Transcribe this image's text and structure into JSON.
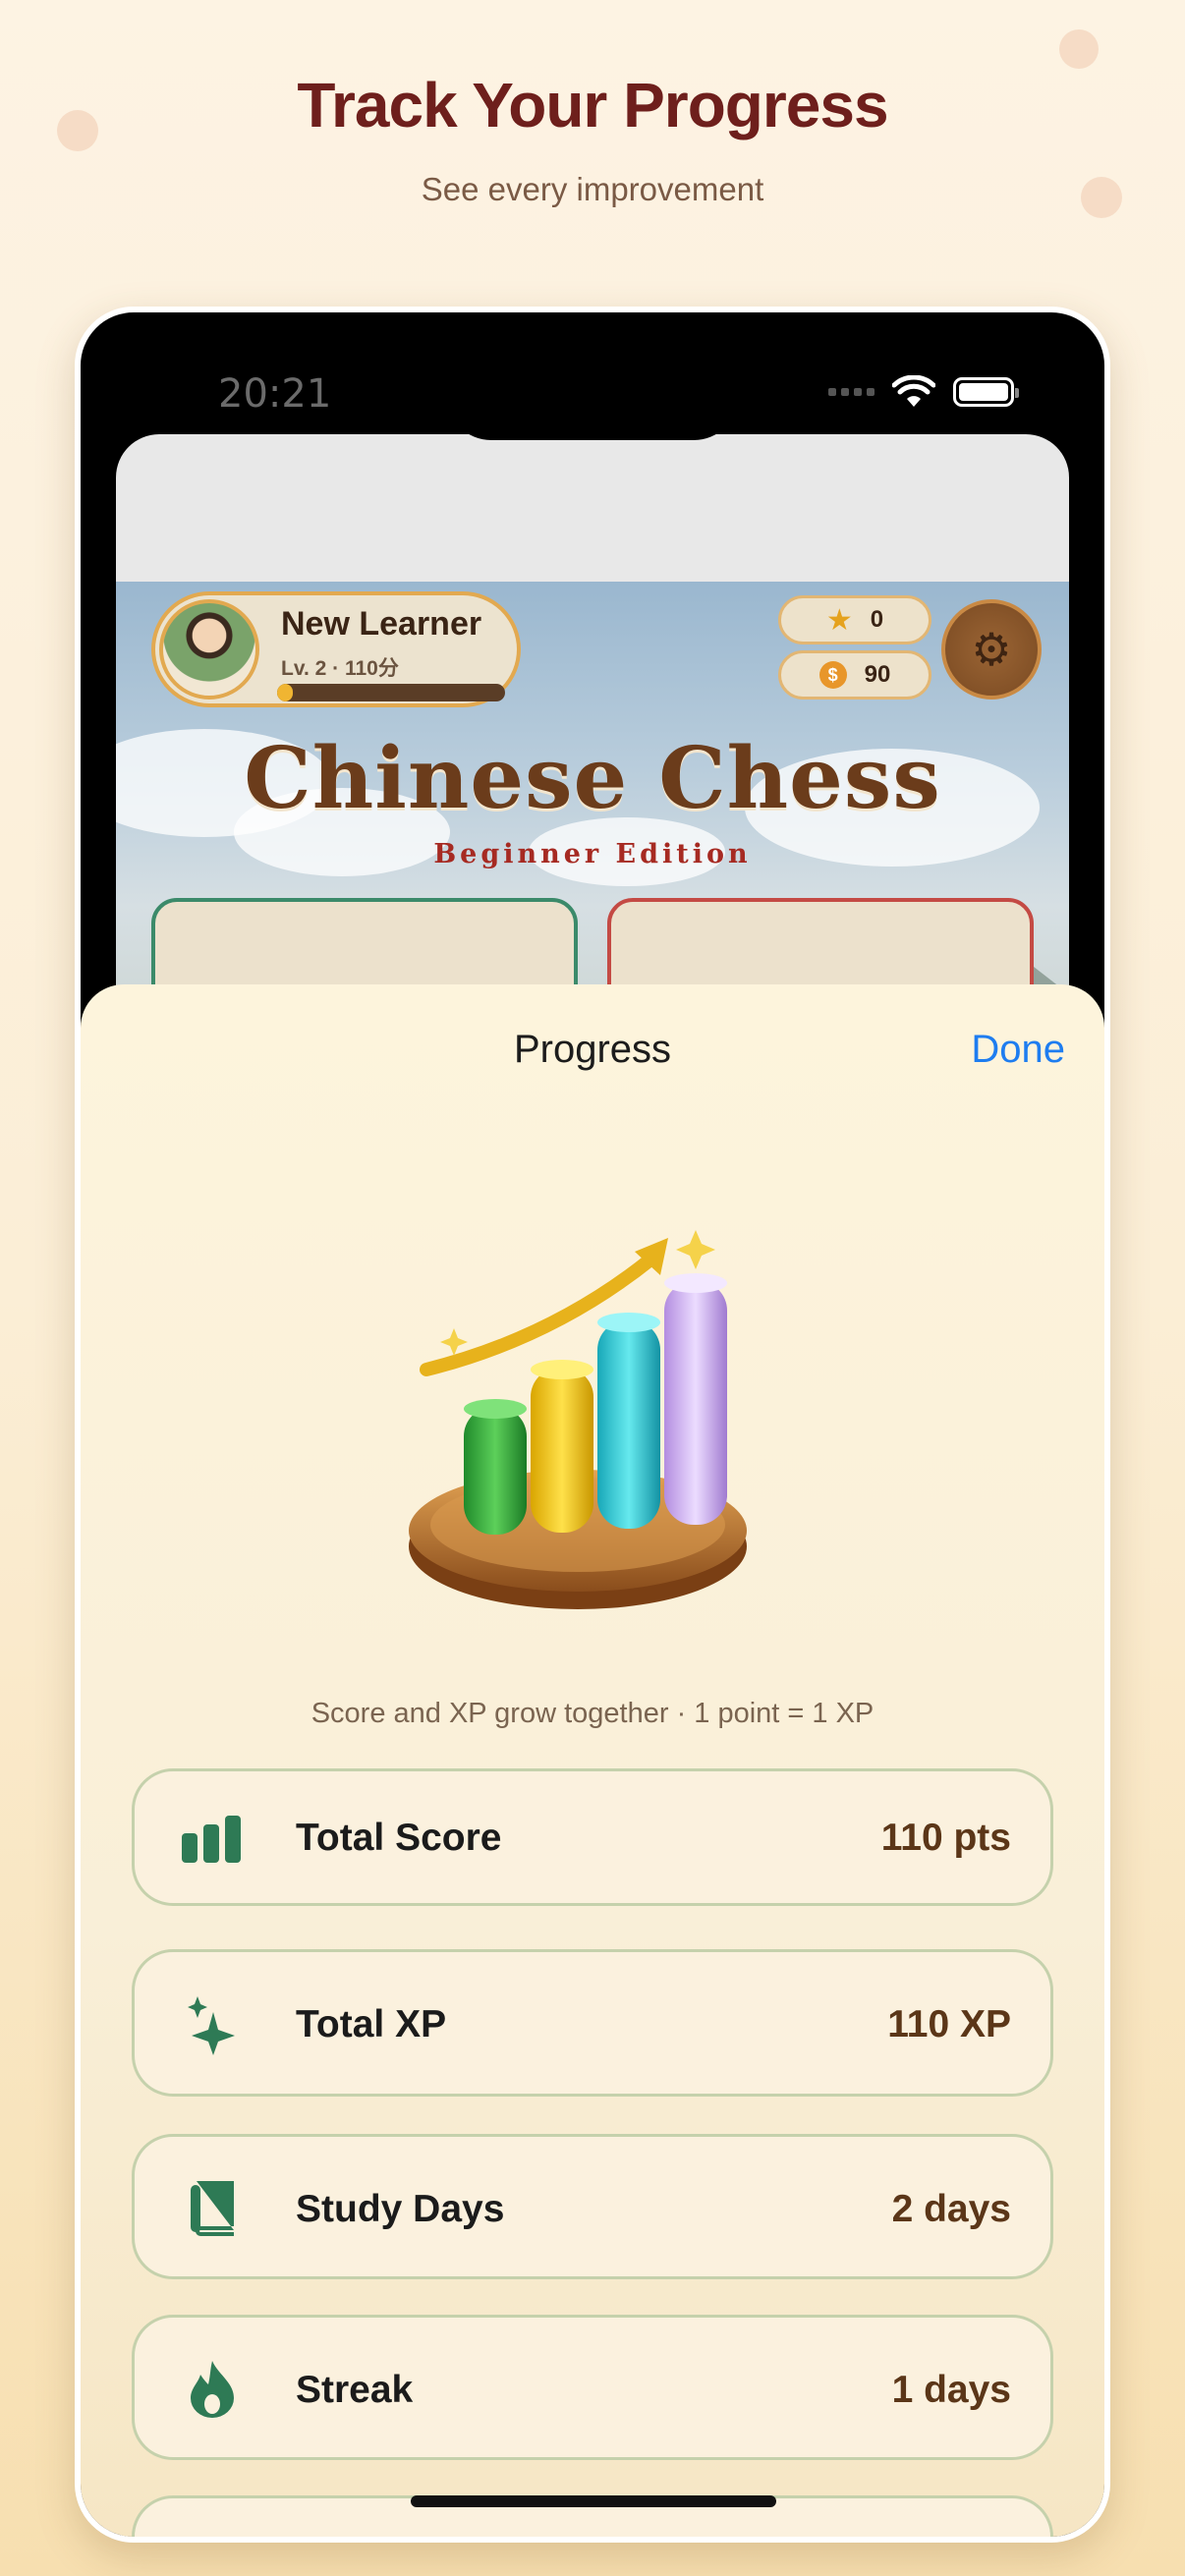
{
  "promo": {
    "headline": "Track Your Progress",
    "subline": "See every improvement"
  },
  "status_bar": {
    "time": "20:21"
  },
  "game": {
    "profile_name": "New Learner",
    "profile_level": "Lv. 2 · 110分",
    "xp_progress_fraction": 0.07,
    "stars": "0",
    "coins": "90",
    "coin_symbol": "$",
    "title": "Chinese Chess",
    "subtitle": "Beginner Edition"
  },
  "sheet": {
    "title": "Progress",
    "done_label": "Done",
    "caption": "Score and XP grow together · 1 point = 1 XP",
    "stats": [
      {
        "label": "Total Score",
        "value": "110 pts",
        "icon": "bar-chart-icon"
      },
      {
        "label": "Total XP",
        "value": "110 XP",
        "icon": "sparkles-icon"
      },
      {
        "label": "Study Days",
        "value": "2 days",
        "icon": "book-icon"
      },
      {
        "label": "Streak",
        "value": "1 days",
        "icon": "flame-icon"
      }
    ]
  },
  "colors": {
    "headline": "#6e1f1c",
    "accent_blue": "#1e7df0",
    "icon_green": "#2e7a55",
    "value_brown": "#5b3618"
  }
}
